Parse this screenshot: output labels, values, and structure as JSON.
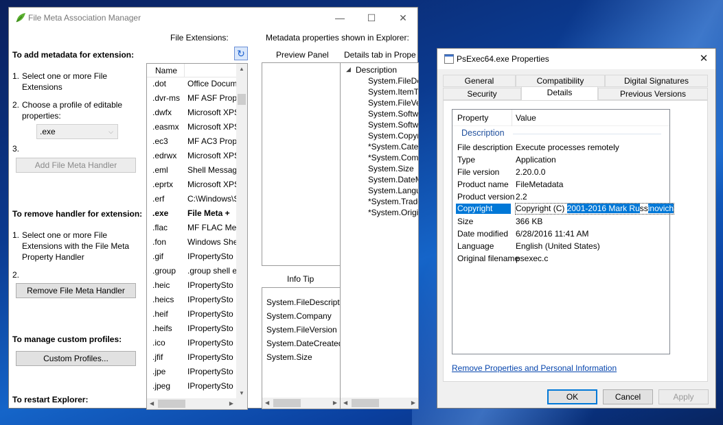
{
  "fm": {
    "title": "File Meta Association Manager",
    "window_controls": {
      "minimize": "—",
      "maximize": "☐",
      "close": "✕"
    },
    "headers": {
      "file_extensions": "File Extensions:",
      "metadata_shown": "Metadata properties shown in Explorer:",
      "preview_panel": "Preview Panel",
      "details_tab": "Details tab in Prope",
      "info_tip": "Info Tip"
    },
    "add": {
      "heading": "To add metadata for extension:",
      "step1_num": "1.",
      "step1_a": "Select one or more File",
      "step1_b": "Extensions",
      "step2_num": "2.",
      "step2_a": "Choose a profile of editable",
      "step2_b": "properties:",
      "profile_value": ".exe",
      "step3_num": "3.",
      "button": "Add File Meta Handler"
    },
    "remove": {
      "heading": "To remove handler for extension:",
      "step1_num": "1.",
      "step1_a": "Select one or more File",
      "step1_b": "Extensions with the File Meta",
      "step1_c": "Property Handler",
      "step2_num": "2.",
      "button": "Remove File Meta Handler"
    },
    "profiles": {
      "heading": "To manage custom profiles:",
      "button": "Custom Profiles..."
    },
    "restart": {
      "heading": "To restart Explorer:"
    },
    "ext_list": {
      "col_name": "Name",
      "rows": [
        {
          "ext": ".dot",
          "handler": "Office Docum"
        },
        {
          "ext": ".dvr-ms",
          "handler": "MF ASF Prope"
        },
        {
          "ext": ".dwfx",
          "handler": "Microsoft XPS"
        },
        {
          "ext": ".easmx",
          "handler": "Microsoft XPS"
        },
        {
          "ext": ".ec3",
          "handler": "MF AC3 Prop"
        },
        {
          "ext": ".edrwx",
          "handler": "Microsoft XPS"
        },
        {
          "ext": ".eml",
          "handler": "Shell Messag"
        },
        {
          "ext": ".eprtx",
          "handler": "Microsoft XPS"
        },
        {
          "ext": ".erf",
          "handler": "C:\\Windows\\S"
        },
        {
          "ext": ".exe",
          "handler": "File Meta +",
          "selected": true
        },
        {
          "ext": ".flac",
          "handler": "MF FLAC Med"
        },
        {
          "ext": ".fon",
          "handler": "Windows She"
        },
        {
          "ext": ".gif",
          "handler": "IPropertySto"
        },
        {
          "ext": ".group",
          "handler": ".group shell e"
        },
        {
          "ext": ".heic",
          "handler": "IPropertySto"
        },
        {
          "ext": ".heics",
          "handler": "IPropertySto"
        },
        {
          "ext": ".heif",
          "handler": "IPropertySto"
        },
        {
          "ext": ".heifs",
          "handler": "IPropertySto"
        },
        {
          "ext": ".ico",
          "handler": "IPropertySto"
        },
        {
          "ext": ".jfif",
          "handler": "IPropertySto"
        },
        {
          "ext": ".jpe",
          "handler": "IPropertySto"
        },
        {
          "ext": ".jpeg",
          "handler": "IPropertySto"
        }
      ]
    },
    "details_tree": {
      "group": "Description",
      "items": [
        "System.FileDe",
        "System.ItemTy",
        "System.FileVe",
        "System.Softw",
        "System.Softw",
        "System.Copyr",
        "*System.Categ",
        "*System.Com",
        "System.Size",
        "System.DateM",
        "System.Langu",
        "*System.Trade",
        "*System.Origi"
      ]
    },
    "info_tip_items": [
      "System.FileDescripti",
      "System.Company",
      "System.FileVersion",
      "System.DateCreated",
      "System.Size"
    ]
  },
  "props": {
    "title": "PsExec64.exe Properties",
    "close": "✕",
    "tabs_row1": [
      "General",
      "Compatibility",
      "Digital Signatures"
    ],
    "tabs_row2": [
      "Security",
      "Details",
      "Previous Versions"
    ],
    "col_property": "Property",
    "col_value": "Value",
    "group": "Description",
    "rows": [
      {
        "k": "File description",
        "v": "Execute processes remotely"
      },
      {
        "k": "Type",
        "v": "Application"
      },
      {
        "k": "File version",
        "v": "2.20.0.0"
      },
      {
        "k": "Product name",
        "v": "FileMetadata"
      },
      {
        "k": "Product version",
        "v": "2.2"
      },
      {
        "k": "Copyright",
        "v_pre": "Copyright (C) ",
        "v_sel1": "2001-2016 Mark Ru",
        "v_mid": "ss",
        "v_sel2": "inovich"
      },
      {
        "k": "Size",
        "v": "366 KB"
      },
      {
        "k": "Date modified",
        "v": "6/28/2016 11:41 AM"
      },
      {
        "k": "Language",
        "v": "English (United States)"
      },
      {
        "k": "Original filename",
        "v": "psexec.c"
      }
    ],
    "remove_link": "Remove Properties and Personal Information",
    "ok": "OK",
    "cancel": "Cancel",
    "apply": "Apply"
  }
}
